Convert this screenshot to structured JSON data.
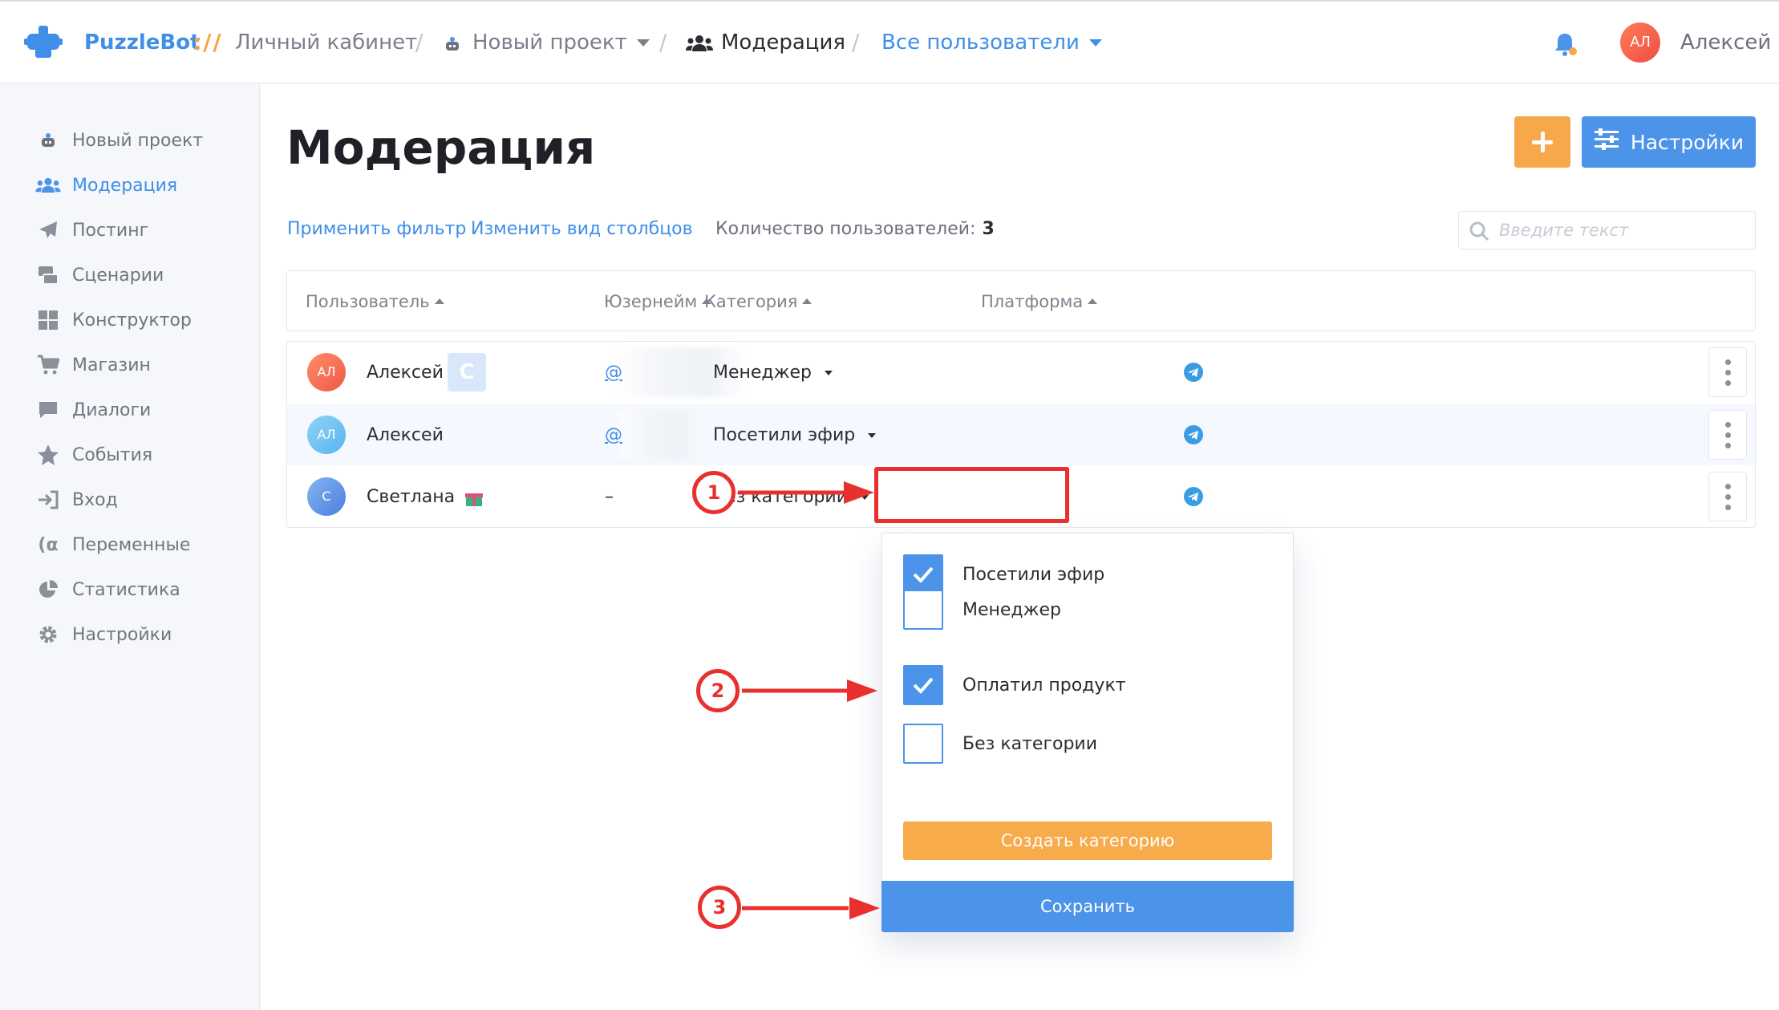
{
  "header": {
    "brand": "PuzzleBot",
    "brand_sep": "://",
    "crumbs": {
      "cabinet": "Личный кабинет",
      "project": "Новый проект",
      "section": "Модерация",
      "filter": "Все пользователи"
    },
    "user_avatar": "АЛ",
    "user_name": "Алексей"
  },
  "sidebar": {
    "items": [
      {
        "label": "Новый проект",
        "icon": "robot-icon"
      },
      {
        "label": "Модерация",
        "icon": "users-icon"
      },
      {
        "label": "Постинг",
        "icon": "paper-plane-icon"
      },
      {
        "label": "Сценарии",
        "icon": "scenarios-icon"
      },
      {
        "label": "Конструктор",
        "icon": "grid-icon"
      },
      {
        "label": "Магазин",
        "icon": "cart-icon"
      },
      {
        "label": "Диалоги",
        "icon": "chat-icon"
      },
      {
        "label": "События",
        "icon": "star-icon"
      },
      {
        "label": "Вход",
        "icon": "sign-in-icon"
      },
      {
        "label": "Переменные",
        "icon": "variable-icon"
      },
      {
        "label": "Статистика",
        "icon": "pie-chart-icon"
      },
      {
        "label": "Настройки",
        "icon": "gear-icon"
      }
    ],
    "active_index": 1
  },
  "main": {
    "title": "Модерация",
    "settings_label": "Настройки",
    "apply_filter": "Применить фильтр",
    "change_columns": "Изменить вид столбцов",
    "count_label": "Количество пользователей:",
    "count_value": "3",
    "search_placeholder": "Введите текст"
  },
  "table": {
    "columns": [
      "Пользователь",
      "Юзернейм",
      "Категория",
      "Платформа"
    ],
    "rows": [
      {
        "avatar": "АЛ",
        "name": "Алексей",
        "badge": "C",
        "username": "@",
        "category": "Менеджер",
        "platform": "telegram-icon"
      },
      {
        "avatar": "АЛ",
        "name": "Алексей",
        "badge": "",
        "username": "@",
        "category": "Посетили эфир",
        "platform": "telegram-icon"
      },
      {
        "avatar": "С",
        "name": "Светлана",
        "badge": "",
        "username": "–",
        "category": "Без категории",
        "platform": "telegram-icon"
      }
    ]
  },
  "dropdown": {
    "options": [
      {
        "label": "Посетили эфир",
        "checked": true
      },
      {
        "label": "Менеджер",
        "checked": false
      },
      {
        "label": "Оплатил продукт",
        "checked": true
      },
      {
        "label": "Без категории",
        "checked": false
      }
    ],
    "create_label": "Создать категорию",
    "save_label": "Сохранить"
  },
  "annotations": [
    "1",
    "2",
    "3"
  ],
  "colors": {
    "accent_blue": "#4c93ea",
    "accent_orange": "#f7a84a",
    "annotation_red": "#e8312f"
  }
}
